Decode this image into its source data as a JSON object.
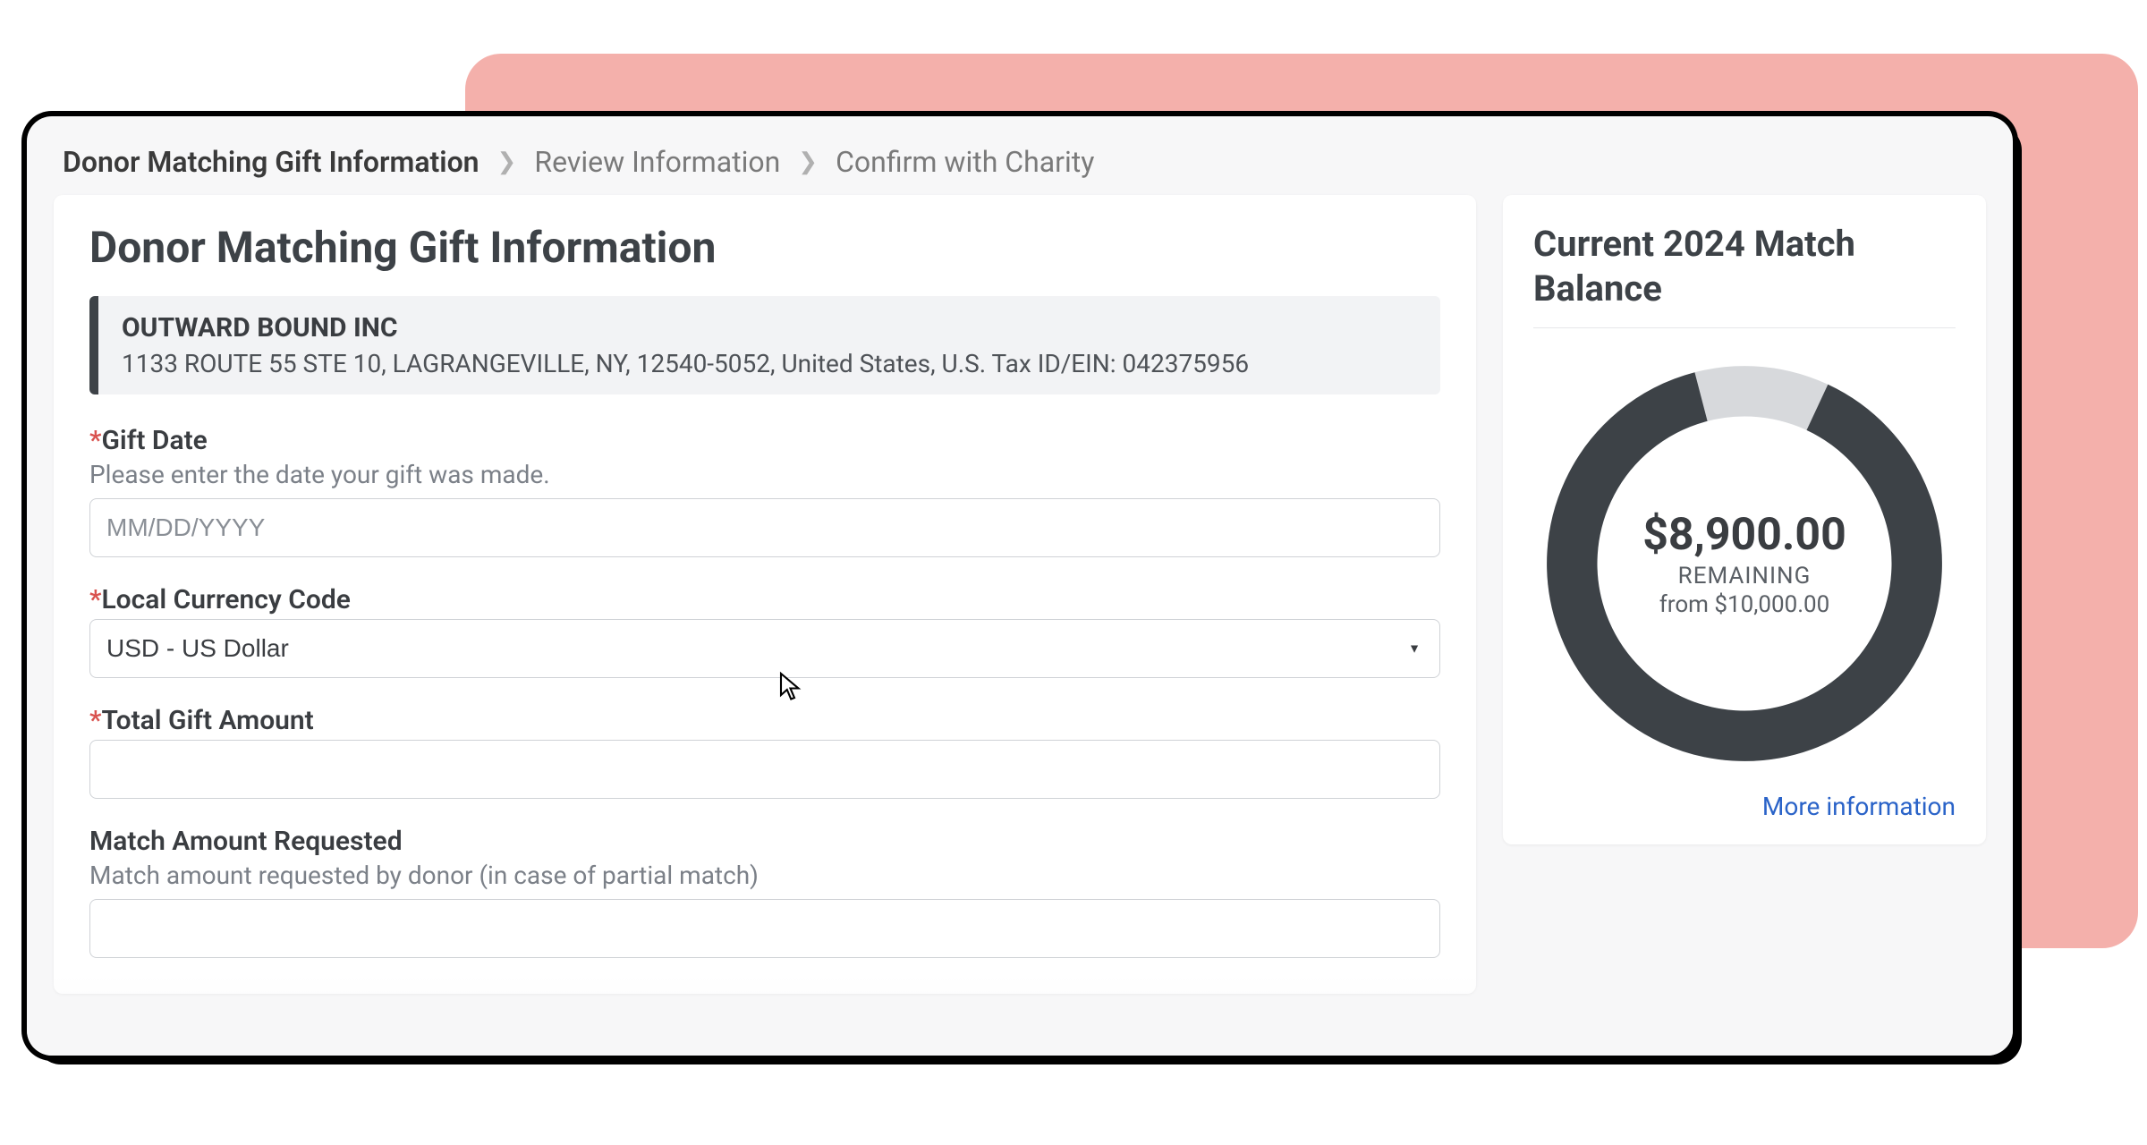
{
  "breadcrumb": {
    "step1": "Donor Matching Gift Information",
    "step2": "Review Information",
    "step3": "Confirm with Charity"
  },
  "page": {
    "title": "Donor Matching Gift Information"
  },
  "org": {
    "name": "OUTWARD BOUND INC",
    "address": "1133 ROUTE 55 STE 10, LAGRANGEVILLE, NY, 12540-5052, United States, U.S. Tax ID/EIN: 042375956"
  },
  "fields": {
    "gift_date": {
      "label": "Gift Date",
      "hint": "Please enter the date your gift was made.",
      "placeholder": "MM/DD/YYYY",
      "value": ""
    },
    "currency": {
      "label": "Local Currency Code",
      "selected": "USD - US Dollar"
    },
    "total_amount": {
      "label": "Total Gift Amount",
      "value": ""
    },
    "match_requested": {
      "label": "Match Amount Requested",
      "hint": "Match amount requested by donor (in case of partial match)",
      "value": ""
    }
  },
  "balance": {
    "title": "Current 2024 Match Balance",
    "amount": "$8,900.00",
    "remaining_label": "REMAINING",
    "from_prefix": "from ",
    "from_amount": "$10,000.00",
    "more_link": "More information"
  },
  "chart_data": {
    "type": "pie",
    "title": "Current 2024 Match Balance",
    "total": 10000,
    "remaining": 8900,
    "used": 1100,
    "series": [
      {
        "name": "Remaining",
        "value": 8900,
        "color": "#3d4247"
      },
      {
        "name": "Used",
        "value": 1100,
        "color": "#d7d9dc"
      }
    ]
  }
}
